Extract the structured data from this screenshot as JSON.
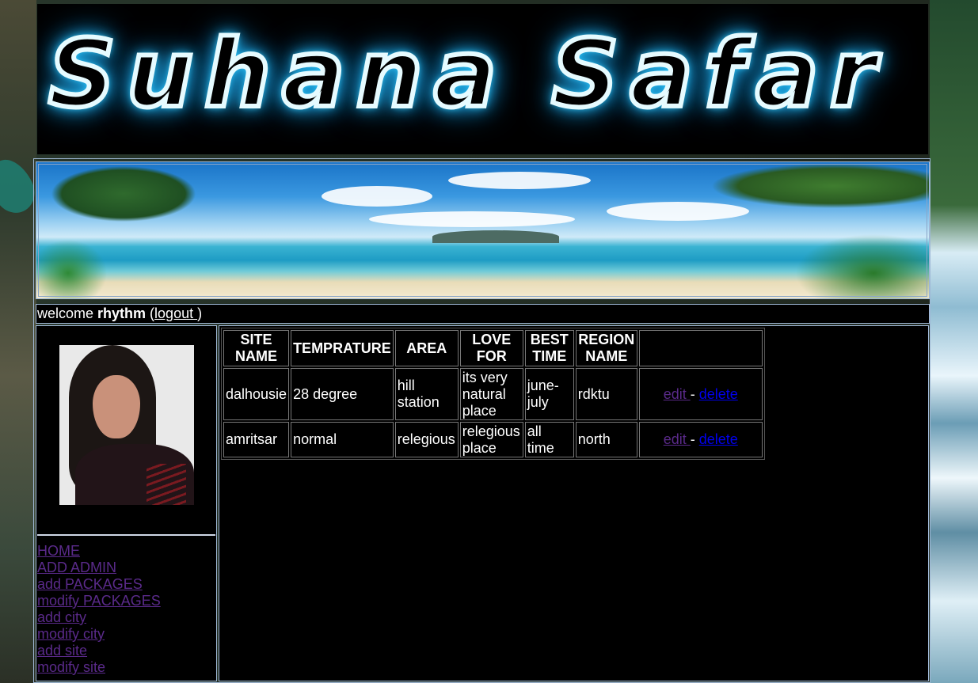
{
  "banner": {
    "title": "Suhana Safar"
  },
  "welcome": {
    "prefix": "welcome ",
    "username": "rhythm",
    "open_paren": " (",
    "logout_label": "logout ",
    "close_paren": ")"
  },
  "nav": {
    "items": [
      {
        "label": "HOME"
      },
      {
        "label": "ADD ADMIN"
      },
      {
        "label": "add PACKAGES"
      },
      {
        "label": "modify PACKAGES"
      },
      {
        "label": "add city"
      },
      {
        "label": "modify city"
      },
      {
        "label": "add site"
      },
      {
        "label": "modify site"
      }
    ]
  },
  "table": {
    "headers": {
      "site_name": "SITE NAME",
      "temprature": "TEMPRATURE",
      "area": "AREA",
      "love_for": "LOVE FOR",
      "best_time": "BEST TIME",
      "region_name": "REGION NAME",
      "actions": ""
    },
    "rows": [
      {
        "site_name": "dalhousie",
        "temprature": "28 degree",
        "area": "hill station",
        "love_for": "its very natural place",
        "best_time": "june-july",
        "region_name": "rdktu",
        "edit_label": "edit ",
        "separator": " - ",
        "delete_label": "delete"
      },
      {
        "site_name": "amritsar",
        "temprature": "normal",
        "area": "relegious",
        "love_for": "relegious place",
        "best_time": "all time",
        "region_name": "north",
        "edit_label": "edit ",
        "separator": " - ",
        "delete_label": "delete"
      }
    ]
  },
  "colors": {
    "background": "#000000",
    "border": "#9fb8d6",
    "visited_link": "#5a2a8a",
    "link": "#0000ee",
    "banner_glow": "#3fd4ff"
  },
  "icons": {
    "avatar": "user-photo",
    "banner": "neon-logo",
    "header_image": "beach-banner-image"
  }
}
